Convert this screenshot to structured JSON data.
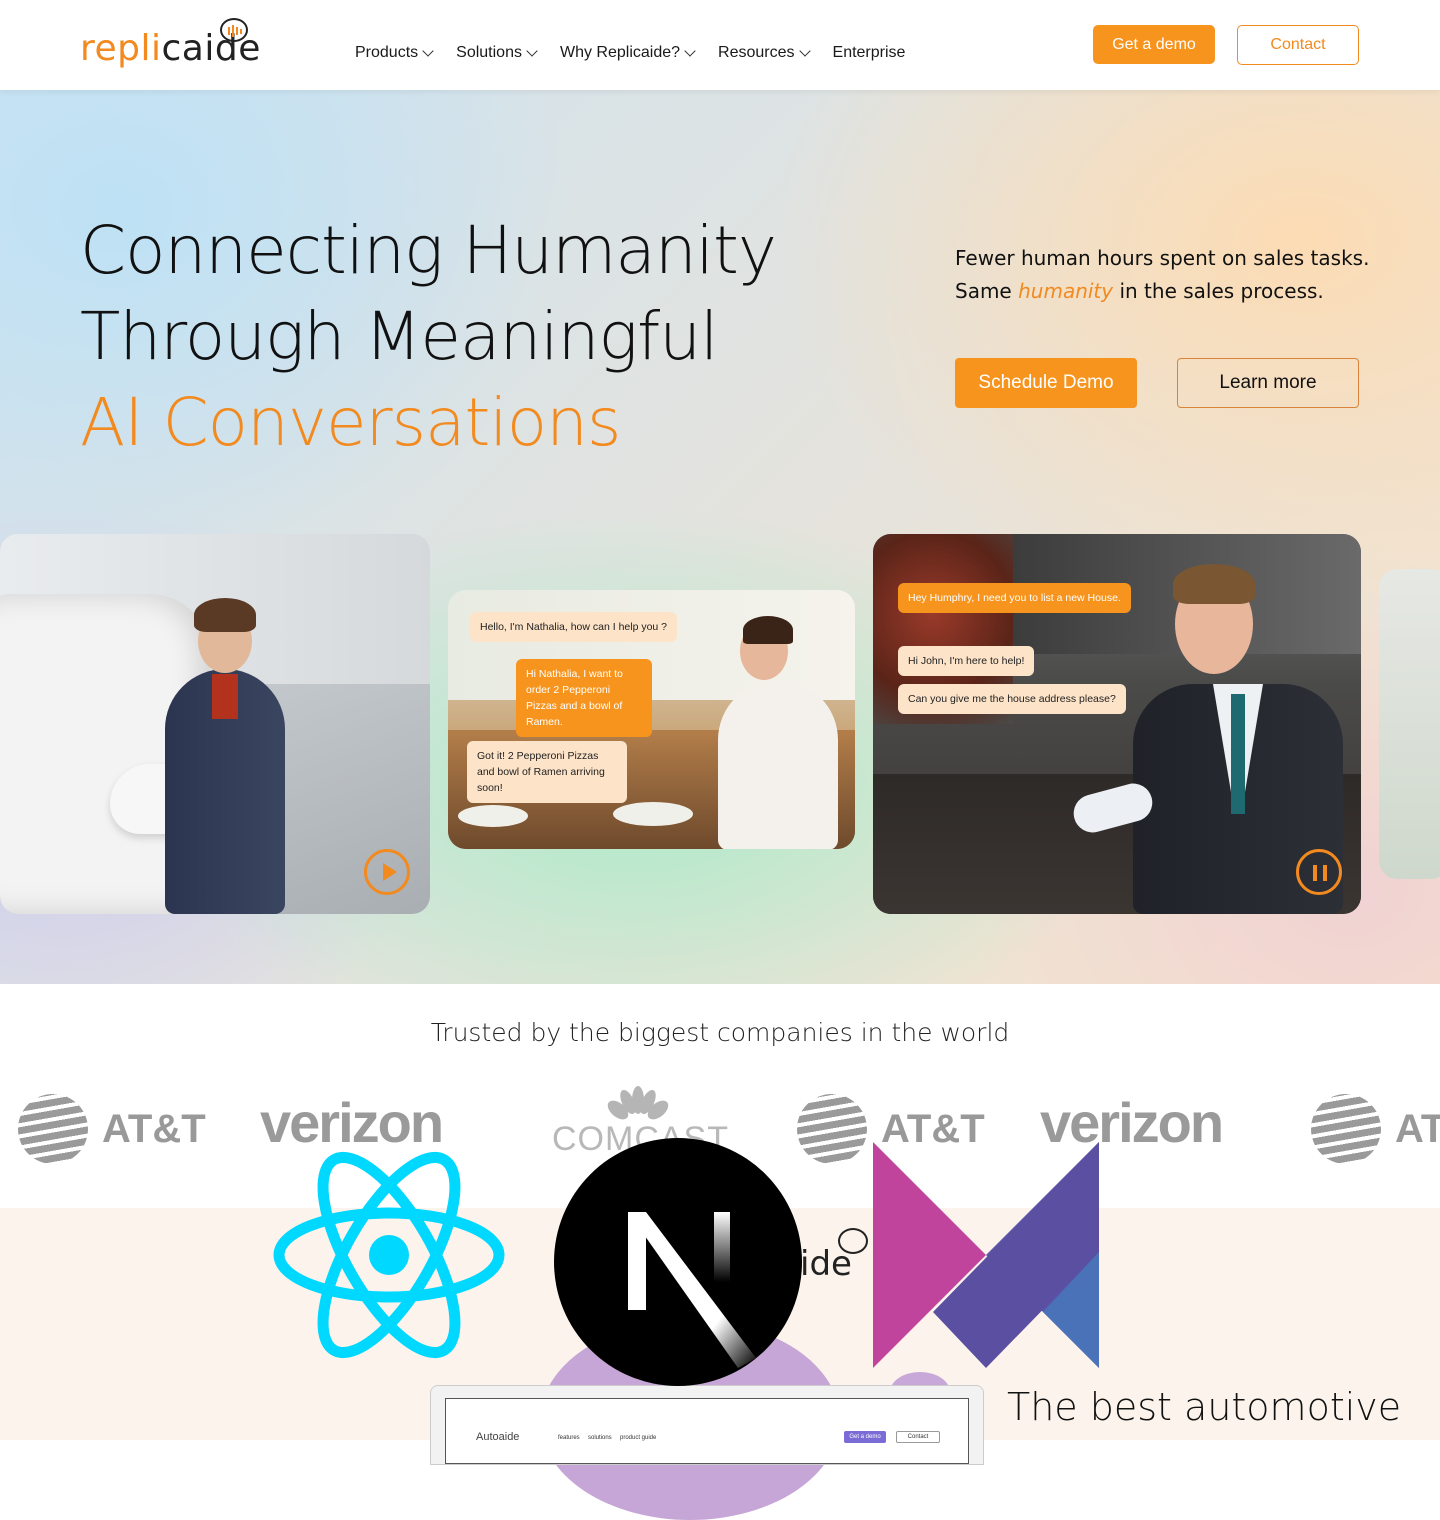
{
  "brand": {
    "part1": "repli",
    "part2": "caide"
  },
  "nav": {
    "items": [
      "Products",
      "Solutions",
      "Why Replicaide?",
      "Resources",
      "Enterprise"
    ],
    "demo_label": "Get a demo",
    "contact_label": "Contact"
  },
  "hero": {
    "line1": "Connecting Humanity",
    "line2": "Through Meaningful",
    "line3": "AI Conversations",
    "sub_line1": "Fewer human hours spent on sales tasks.",
    "sub_pre": "Same ",
    "sub_em": "humanity",
    "sub_post": " in the sales process.",
    "schedule_label": "Schedule Demo",
    "learn_label": "Learn more"
  },
  "chats": {
    "c1": "Hello, I'm Nathalia, how can I help you ?",
    "c2": "Hi Nathalia, I want to order 2 Pepperoni Pizzas and a bowl of Ramen.",
    "c3": "Got it! 2 Pepperoni Pizzas and bowl of Ramen arriving soon!",
    "c4": "Hey Humphry, I need you to list a new House.",
    "c5": "Hi John, I'm here to help!",
    "c6": "Can you give me the house address please?"
  },
  "trusted": {
    "heading": "Trusted by the biggest companies in the world",
    "att": "AT&T",
    "verizon": "verizon",
    "comcast": "COMCAST"
  },
  "section2": {
    "brand_suffix": "ide",
    "heading": "The best automotive",
    "laptop_brand": "Autoaide",
    "laptop_nav": [
      "features",
      "solutions",
      "product guide"
    ],
    "laptop_demo": "Get a demo",
    "laptop_contact": "Contact"
  },
  "colors": {
    "accent": "#f7941d",
    "text": "#111111"
  },
  "icons": [
    "chevron-down-icon",
    "play-icon",
    "pause-icon",
    "react-logo",
    "nextjs-logo",
    "m-logo"
  ]
}
